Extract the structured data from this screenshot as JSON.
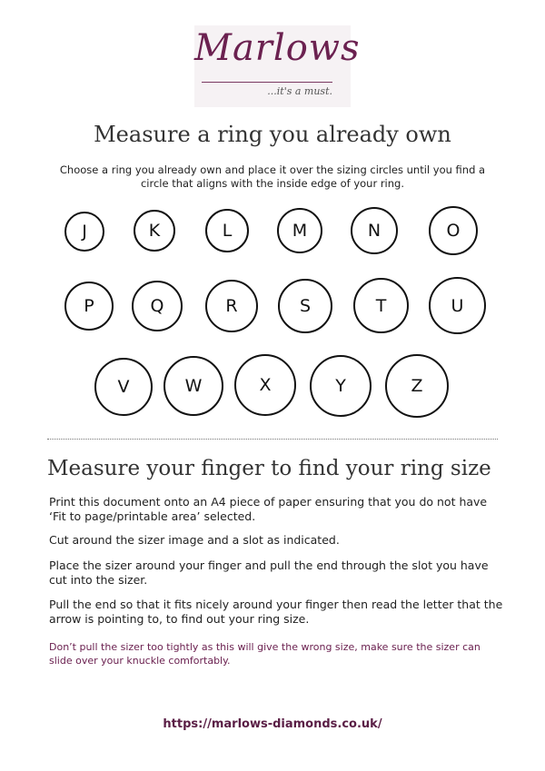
{
  "logo": {
    "name": "Marlows",
    "tagline": "...it's a must."
  },
  "section1": {
    "title": "Measure a ring you already own",
    "intro": "Choose a ring you already own and place it over the sizing circles until you find a circle that aligns with the inside edge of your ring."
  },
  "sizes": [
    "J",
    "K",
    "L",
    "M",
    "N",
    "O",
    "P",
    "Q",
    "R",
    "S",
    "T",
    "U",
    "V",
    "W",
    "X",
    "Y",
    "Z"
  ],
  "section2": {
    "title": "Measure your finger to find your ring size",
    "p1": "Print this document onto an A4 piece of paper ensuring that you do not have ‘Fit to page/printable area’ selected.",
    "p2": "Cut around the sizer image and a slot as indicated.",
    "p3": "Place the sizer around your finger and pull the end through the slot you have cut into the sizer.",
    "p4": "Pull the end so that it fits nicely around your finger then read the letter that the arrow is pointing to, to find out your ring size.",
    "note": "Don’t pull the sizer too tightly as this will give the wrong size, make sure the sizer can slide over your knuckle comfortably."
  },
  "footer": {
    "url": "https://marlows-diamonds.co.uk/"
  },
  "colors": {
    "brand": "#6b2150",
    "text": "#222222"
  }
}
